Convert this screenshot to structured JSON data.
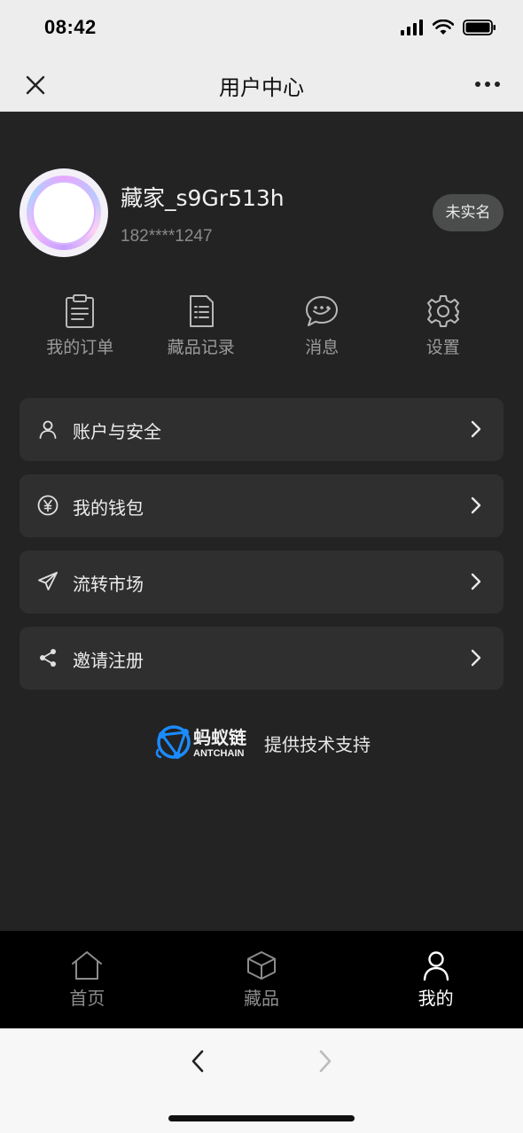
{
  "status_bar": {
    "time": "08:42"
  },
  "nav": {
    "title": "用户中心"
  },
  "profile": {
    "username": "藏家_s9Gr513h",
    "phone": "182****1247",
    "verify_badge": "未实名"
  },
  "quick_actions": [
    {
      "label": "我的订单",
      "icon": "clipboard-icon"
    },
    {
      "label": "藏品记录",
      "icon": "document-list-icon"
    },
    {
      "label": "消息",
      "icon": "chat-bubble-icon"
    },
    {
      "label": "设置",
      "icon": "gear-icon"
    }
  ],
  "menu": [
    {
      "label": "账户与安全",
      "icon": "user-icon"
    },
    {
      "label": "我的钱包",
      "icon": "yuan-icon"
    },
    {
      "label": "流转市场",
      "icon": "paper-plane-icon"
    },
    {
      "label": "邀请注册",
      "icon": "share-icon"
    }
  ],
  "powered_by": {
    "logo_cn": "蚂蚁链",
    "logo_en": "ANTCHAIN",
    "text": "提供技术支持"
  },
  "tabs": [
    {
      "label": "首页",
      "icon": "home-icon",
      "active": false
    },
    {
      "label": "藏品",
      "icon": "cube-icon",
      "active": false
    },
    {
      "label": "我的",
      "icon": "person-icon",
      "active": true
    }
  ],
  "colors": {
    "background": "#232323",
    "card": "#2f2f2f",
    "tab_bar": "#000000",
    "badge": "#4a4d4b"
  }
}
